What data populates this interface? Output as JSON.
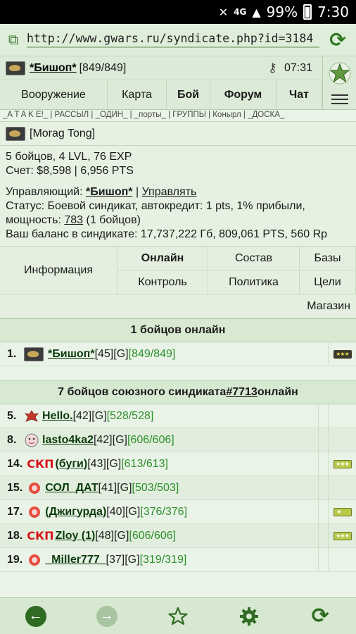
{
  "statusbar": {
    "network": "4G",
    "battery": "99%",
    "time": "7:30"
  },
  "browser": {
    "url": "http://www.gwars.ru/syndicate.php?id=3184"
  },
  "header": {
    "player_name": "*Бишоп*",
    "player_hp": "[849/849]",
    "time": "07:31",
    "nav": [
      "Вооружение",
      "Карта",
      "Бой",
      "Форум",
      "Чат"
    ]
  },
  "links_line": "_A T A K E!_ | РАССЫЛ | _ОДИН_ | _порты_ | ГРУППЫ | Конырл | _ДОСКА_",
  "syndicate": {
    "name": "[Morag Tong]",
    "stats_line1": "5 бойцов, 4 LVL, 76 EXP",
    "stats_line2": "Счет: $8,598 | 6,956 PTS",
    "manager_label": "Управляющий: ",
    "manager_name": "*Бишоп*",
    "manage_link": "Управлять",
    "status_line": "Статус: Боевой синдикат, автокредит: 1 pts, 1% прибыли,",
    "power_label": "мощность: ",
    "power_value": "783",
    "power_suffix": " (1 бойцов)",
    "balance_line": "Ваш баланс в синдикате: 17,737,222 Гб, 809,061 PTS, 560 Rp"
  },
  "tabs": {
    "info": "Информация",
    "online": "Онлайн",
    "roster": "Состав",
    "bases": "Базы",
    "control": "Контроль",
    "politics": "Политика",
    "goals": "Цели",
    "shop": "Магазин"
  },
  "online": {
    "heading": "1 бойцов онлайн",
    "members": [
      {
        "num": "1.",
        "name": "*Бишоп*",
        "meta": "[45][G]",
        "hp": "[849/849]"
      }
    ]
  },
  "allied": {
    "heading_prefix": "7 бойцов союзного синдиката ",
    "heading_link": "#7713",
    "heading_suffix": " онлайн",
    "members": [
      {
        "num": "5.",
        "clan": "",
        "name": "Hello.",
        "meta": "[42][G]",
        "hp": "[528/528]"
      },
      {
        "num": "8.",
        "clan": "",
        "name": "lasto4ka2",
        "meta": "[42][G]",
        "hp": "[606/606]"
      },
      {
        "num": "14.",
        "clan": "СКП",
        "name": "(буги)",
        "meta": "[43][G]",
        "hp": "[613/613]"
      },
      {
        "num": "15.",
        "clan": "",
        "name": "СОЛ_ДАТ",
        "meta": "[41][G]",
        "hp": "[503/503]"
      },
      {
        "num": "17.",
        "clan": "",
        "name": "(Джигурда)",
        "meta": "[40][G]",
        "hp": "[376/376]"
      },
      {
        "num": "18.",
        "clan": "СКП",
        "name": "Zloy (1)",
        "meta": "[48][G]",
        "hp": "[606/606]"
      },
      {
        "num": "19.",
        "clan": "",
        "name": "_Miller777_",
        "meta": "[37][G]",
        "hp": "[319/319]"
      }
    ]
  },
  "icons": {
    "back": "arrow-left-icon",
    "forward": "arrow-right-icon",
    "star": "star-icon",
    "settings": "gear-icon",
    "reload": "reload-icon"
  },
  "colors": {
    "accent": "#2f6b23",
    "hp_green": "#2c8f2c",
    "clan_red": "#d8141a"
  }
}
